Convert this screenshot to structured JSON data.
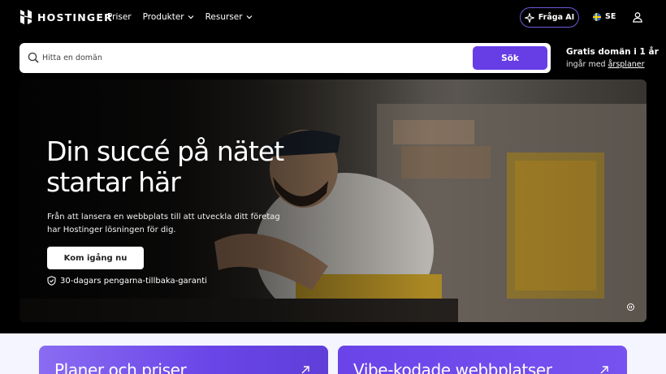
{
  "header": {
    "logo_text": "HOSTINGER",
    "nav": [
      {
        "label": "Priser",
        "has_dropdown": false
      },
      {
        "label": "Produkter",
        "has_dropdown": true
      },
      {
        "label": "Resurser",
        "has_dropdown": true
      }
    ],
    "ask_ai_label": "Fråga AI",
    "language_code": "SE",
    "icons": {
      "logo": "hostinger-logo",
      "ai": "sparkle-icon",
      "flag": "sweden-flag-icon",
      "user": "user-icon"
    }
  },
  "search": {
    "placeholder": "Hitta en domän",
    "value": "",
    "button_label": "Sök"
  },
  "promo": {
    "title": "Gratis domän i 1 år",
    "subtitle_prefix": "ingår med ",
    "subtitle_link": "årsplaner"
  },
  "hero": {
    "title": "Din succé på nätet startar här",
    "description": "Från att lansera en webbplats till att utveckla ditt företag har Hostinger lösningen för dig.",
    "cta_label": "Kom igång nu",
    "guarantee": "30-dagars pengarna-tillbaka-garanti"
  },
  "cards": [
    {
      "title": "Planer och priser"
    },
    {
      "title": "Vibe-kodade webbplatser"
    }
  ],
  "colors": {
    "accent": "#673de6",
    "background": "#000000",
    "lower_bg": "#f4f5ff"
  }
}
